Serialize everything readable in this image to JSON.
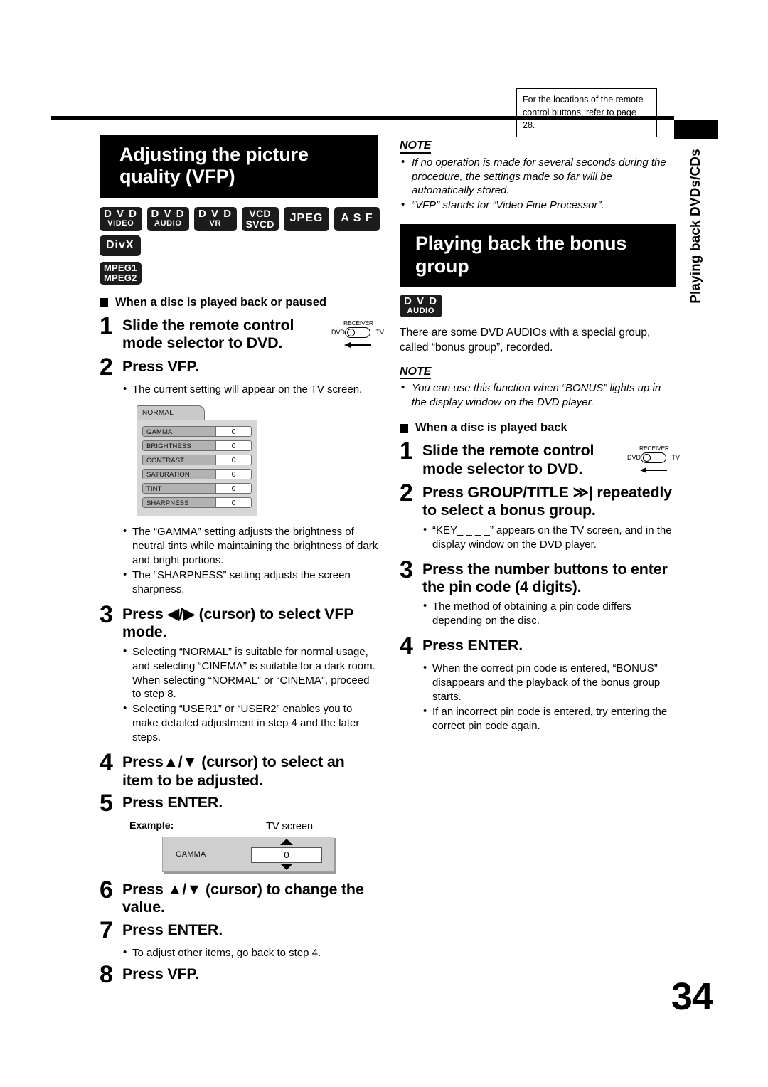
{
  "page": {
    "number": "34",
    "side_tab": "Playing back DVDs/CDs",
    "reference_box": "For the locations of the remote control buttons, refer to page 28."
  },
  "left_column": {
    "section_title": "Adjusting the picture quality (VFP)",
    "badges": [
      {
        "line1": "D V D",
        "line2": "VIDEO",
        "type": "two"
      },
      {
        "line1": "D V D",
        "line2": "AUDIO",
        "type": "two"
      },
      {
        "line1": "D V D",
        "line2": "VR",
        "type": "two"
      },
      {
        "line1": "VCD",
        "line2": "SVCD",
        "type": "eq"
      },
      {
        "line1": "JPEG",
        "type": "single"
      },
      {
        "line1": "A S F",
        "type": "single"
      },
      {
        "line1": "DivX",
        "type": "single"
      }
    ],
    "badges_row2": [
      {
        "line1": "MPEG1",
        "line2": "MPEG2",
        "type": "mpeg"
      }
    ],
    "subhead": "When a disc is played back or paused",
    "steps": [
      {
        "num": "1",
        "text": "Slide the remote control mode selector to DVD.",
        "has_mode_icon": true
      },
      {
        "num": "2",
        "text": "Press VFP.",
        "bullets": [
          "The current setting will appear on the TV screen."
        ]
      },
      {
        "num": "3",
        "text": "Press ◀/▶ (cursor) to select VFP mode.",
        "bullets": [
          "Selecting “NORMAL” is suitable for normal usage, and selecting “CINEMA” is suitable for a dark room. When selecting “NORMAL” or “CINEMA”, proceed to step 8.",
          "Selecting “USER1” or “USER2” enables you to make detailed adjustment in step 4 and the later steps."
        ]
      },
      {
        "num": "4",
        "text": "Press▲/▼ (cursor) to select an item to be adjusted."
      },
      {
        "num": "5",
        "text": "Press ENTER."
      },
      {
        "num": "6",
        "text": "Press ▲/▼ (cursor) to change the value."
      },
      {
        "num": "7",
        "text": "Press ENTER.",
        "bullets": [
          "To adjust other items, go back to step 4."
        ]
      },
      {
        "num": "8",
        "text": "Press VFP."
      }
    ],
    "panel_bullets": [
      "The “GAMMA” setting adjusts the brightness of neutral tints while maintaining the brightness of dark and bright portions.",
      "The “SHARPNESS” setting adjusts the screen sharpness."
    ],
    "vfp_panel": {
      "tab_label": "NORMAL",
      "rows": [
        {
          "name": "GAMMA",
          "value": "0"
        },
        {
          "name": "BRIGHTNESS",
          "value": "0"
        },
        {
          "name": "CONTRAST",
          "value": "0"
        },
        {
          "name": "SATURATION",
          "value": "0"
        },
        {
          "name": "TINT",
          "value": "0"
        },
        {
          "name": "SHARPNESS",
          "value": "0"
        }
      ]
    },
    "example": {
      "label": "Example:",
      "tv_screen_label": "TV screen",
      "item_name": "GAMMA",
      "value": "0"
    },
    "mode_icon": {
      "receiver": "RECEIVER",
      "dvd": "DVD",
      "tv": "TV"
    }
  },
  "right_column": {
    "note1": {
      "title": "NOTE",
      "items": [
        "If no operation is made for several seconds during the procedure, the settings made so far will be automatically stored.",
        "“VFP” stands for “Video Fine Processor”."
      ]
    },
    "section_title": "Playing back the bonus group",
    "badge": {
      "line1": "D V D",
      "line2": "AUDIO"
    },
    "intro": "There are some DVD AUDIOs with a special group, called “bonus group”, recorded.",
    "note2": {
      "title": "NOTE",
      "items": [
        "You can use this function when “BONUS” lights up in the display window on the DVD player."
      ]
    },
    "subhead": "When a disc is played back",
    "steps": [
      {
        "num": "1",
        "text": "Slide the remote control mode selector to DVD.",
        "has_mode_icon": true
      },
      {
        "num": "2",
        "text": "Press GROUP/TITLE ≫| repeatedly to select a bonus group.",
        "bullets": [
          "“KEY_ _ _ _” appears on the TV screen, and in the display window on the DVD player."
        ]
      },
      {
        "num": "3",
        "text": "Press the number buttons to enter the pin code (4 digits).",
        "bullets": [
          "The method of obtaining a pin code differs depending on the disc."
        ]
      },
      {
        "num": "4",
        "text": "Press ENTER.",
        "bullets": [
          "When the correct pin code is entered, “BONUS” disappears and the playback of the bonus group starts.",
          "If an incorrect pin code is entered, try entering the correct pin code again."
        ]
      }
    ],
    "mode_icon": {
      "receiver": "RECEIVER",
      "dvd": "DVD",
      "tv": "TV"
    }
  }
}
